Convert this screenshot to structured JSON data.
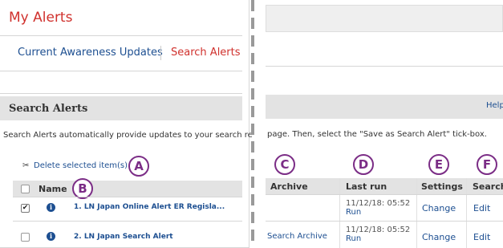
{
  "left": {
    "title": "My Alerts",
    "tabs": {
      "current_awareness": "Current Awareness Updates",
      "search_alerts": "Search Alerts"
    },
    "section_title": "Search Alerts",
    "description": "Search Alerts automatically provide updates to your search re",
    "delete_link": "Delete selected item(s)",
    "table_header_name": "Name",
    "rows": [
      {
        "name": "1. LN Japan Online Alert ER Regisla...",
        "checked": true
      },
      {
        "name": "2. LN Japan Search Alert",
        "checked": false
      }
    ]
  },
  "right": {
    "help_text": "Help",
    "description": "page. Then, select the \"Save as Search Alert\" tick-box.",
    "columns": {
      "archive": "Archive",
      "last_run": "Last run",
      "settings": "Settings",
      "search": "Search"
    },
    "rows": [
      {
        "archive": "",
        "last_run_date": "11/12/18: 05:52",
        "run": "Run",
        "settings": "Change",
        "search": "Edit"
      },
      {
        "archive": "Search Archive",
        "last_run_date": "11/12/18: 05:52",
        "run": "Run",
        "settings": "Change",
        "search": "Edit"
      }
    ]
  },
  "callouts": {
    "a": "A",
    "b": "B",
    "c": "C",
    "d": "D",
    "e": "E",
    "f": "F"
  },
  "colors": {
    "accent_red": "#d0312d",
    "link_blue": "#1d4f91",
    "callout_purple": "#7b2d86"
  }
}
